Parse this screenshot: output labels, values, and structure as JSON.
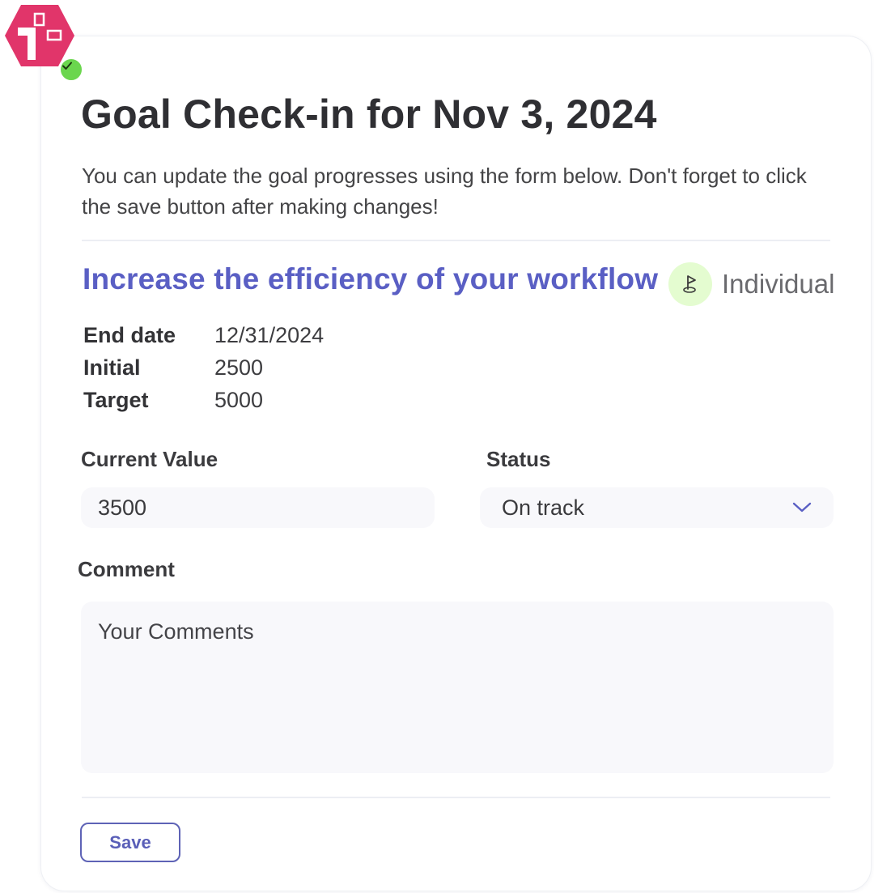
{
  "page": {
    "title": "Goal Check-in for Nov 3, 2024",
    "intro": "You can update the goal progresses using the form below. Don't forget to click the save button after making changes!"
  },
  "goal": {
    "title": "Increase the efficiency of your workflow",
    "type_label": "Individual",
    "type_icon": "golf-flag-icon",
    "details": [
      {
        "key": "End date",
        "value": "12/31/2024"
      },
      {
        "key": "Initial",
        "value": "2500"
      },
      {
        "key": "Target",
        "value": "5000"
      }
    ]
  },
  "form": {
    "current_value_label": "Current Value",
    "current_value": "3500",
    "status_label": "Status",
    "status_value": "On track",
    "comment_label": "Comment",
    "comment_placeholder": "Your Comments",
    "save_label": "Save"
  },
  "colors": {
    "accent": "#5a5fc4",
    "logo": "#e1356a",
    "check_badge": "#6bd64e",
    "type_chip_bg": "#e4fcd0"
  }
}
